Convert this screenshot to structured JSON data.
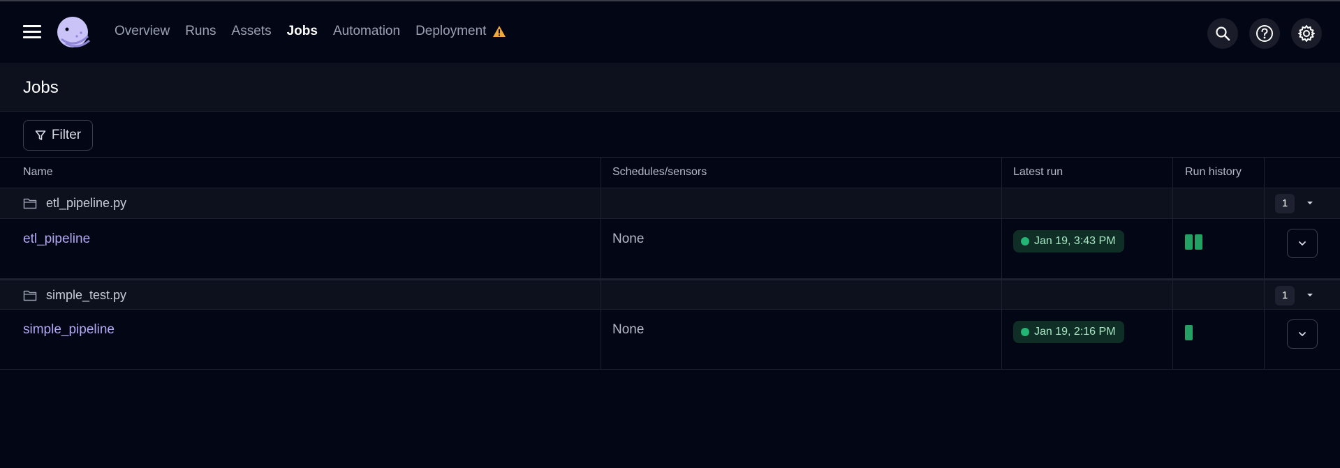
{
  "nav": {
    "items": [
      {
        "label": "Overview",
        "active": false
      },
      {
        "label": "Runs",
        "active": false
      },
      {
        "label": "Assets",
        "active": false
      },
      {
        "label": "Jobs",
        "active": true
      },
      {
        "label": "Automation",
        "active": false
      },
      {
        "label": "Deployment",
        "active": false,
        "icon": "warning-icon"
      }
    ],
    "warning_color": "#f2a73b",
    "right_icons": [
      "search-icon",
      "help-icon",
      "gear-icon"
    ]
  },
  "page": {
    "title": "Jobs"
  },
  "filter": {
    "label": "Filter",
    "icon": "filter-icon"
  },
  "table": {
    "columns": [
      "Name",
      "Schedules/sensors",
      "Latest run",
      "Run history"
    ],
    "groups": [
      {
        "name": "etl_pipeline.py",
        "count": "1",
        "jobs": [
          {
            "name": "etl_pipeline",
            "schedules": "None",
            "latest_run": "Jan 19, 3:43 PM",
            "latest_status": "success",
            "run_history": [
              "success",
              "success"
            ]
          }
        ]
      },
      {
        "name": "simple_test.py",
        "count": "1",
        "jobs": [
          {
            "name": "simple_pipeline",
            "schedules": "None",
            "latest_run": "Jan 19, 2:16 PM",
            "latest_status": "success",
            "run_history": [
              "success"
            ]
          }
        ]
      }
    ]
  },
  "colors": {
    "background": "#030615",
    "link": "#b4a8f5",
    "success": "#22b573"
  }
}
